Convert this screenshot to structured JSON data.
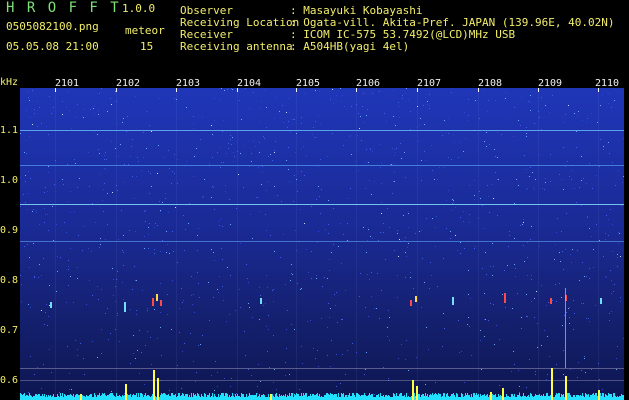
{
  "app": {
    "letters": "H R O F F T",
    "version": "1.0.0",
    "filename": "0505082100.png",
    "datetime": "05.05.08 21:00",
    "meteor_label": "meteor",
    "meteor_count": "15"
  },
  "info": [
    {
      "key": "Observer",
      "value": ": Masayuki Kobayashi"
    },
    {
      "key": "Receiving Location",
      "value": ": Ogata-vill. Akita-Pref. JAPAN (139.96E, 40.02N)"
    },
    {
      "key": "Receiver",
      "value": ": ICOM IC-575 53.7492(@LCD)MHz USB"
    },
    {
      "key": "Receiving antenna",
      "value": ": A504HB(yagi 4el)"
    }
  ],
  "axis": {
    "unit": "kHz",
    "y_labels": [
      "1.1",
      "1.0",
      "0.9",
      "0.8",
      "0.7",
      "0.6"
    ],
    "x_labels": [
      "2101",
      "2102",
      "2103",
      "2104",
      "2105",
      "2106",
      "2107",
      "2108",
      "2109",
      "2110"
    ]
  },
  "colors": {
    "background": "#000000",
    "header_green": "#7fe07a",
    "header_yellow": "#f2ee6a",
    "spectrum_blue": "#1a2a8a",
    "meteor_red": "#ff4040",
    "trace_cyan": "#22e0ff",
    "spike_yellow": "#ffff40"
  }
}
